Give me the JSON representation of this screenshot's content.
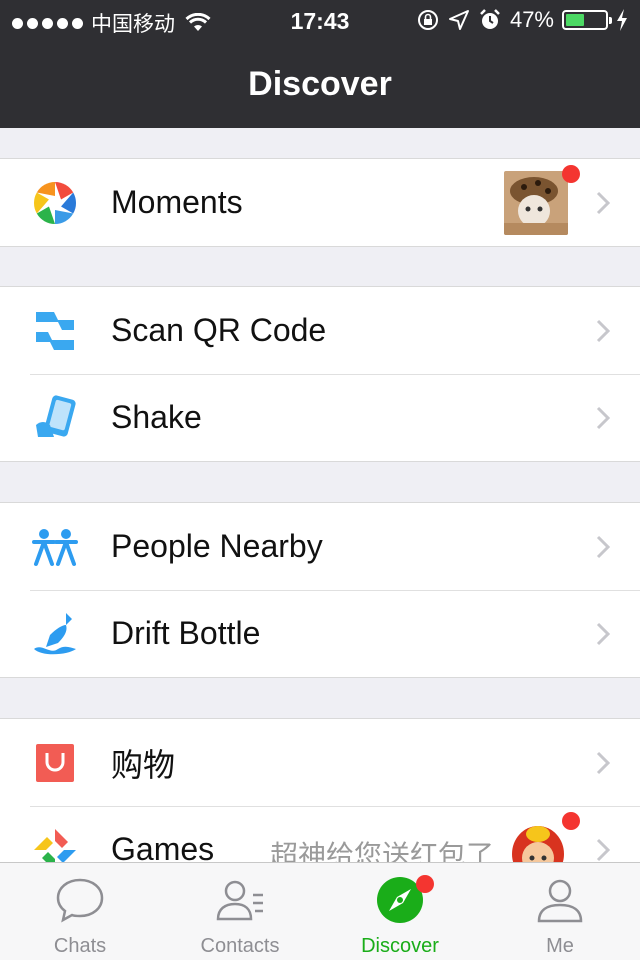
{
  "status_bar": {
    "carrier": "中国移动",
    "time": "17:43",
    "battery": "47%",
    "battery_level": 0.47,
    "signal_icon": "signal-dots-icon",
    "wifi_icon": "wifi-icon"
  },
  "nav": {
    "title": "Discover"
  },
  "groups": [
    {
      "items": [
        {
          "label": "Moments",
          "icon": "moments-icon"
        }
      ]
    },
    {
      "items": [
        {
          "label": "Scan QR Code",
          "icon": "scan-qr-icon"
        },
        {
          "label": "Shake",
          "icon": "shake-icon"
        }
      ]
    },
    {
      "items": [
        {
          "label": "People Nearby",
          "icon": "people-nearby-icon"
        },
        {
          "label": "Drift Bottle",
          "icon": "drift-bottle-icon"
        }
      ]
    },
    {
      "items": [
        {
          "label": "购物",
          "icon": "shopping-icon"
        },
        {
          "label": "Games",
          "icon": "games-icon",
          "note": "超神给您送红包了"
        }
      ]
    }
  ],
  "tabbar": {
    "tabs": [
      {
        "label": "Chats",
        "icon": "chat-bubble-icon"
      },
      {
        "label": "Contacts",
        "icon": "contacts-icon"
      },
      {
        "label": "Discover",
        "icon": "compass-icon",
        "active": true
      },
      {
        "label": "Me",
        "icon": "person-icon"
      }
    ]
  },
  "colors": {
    "accent": "#1aad19",
    "nav_bg": "#2f2f33",
    "badge": "#f43530"
  }
}
